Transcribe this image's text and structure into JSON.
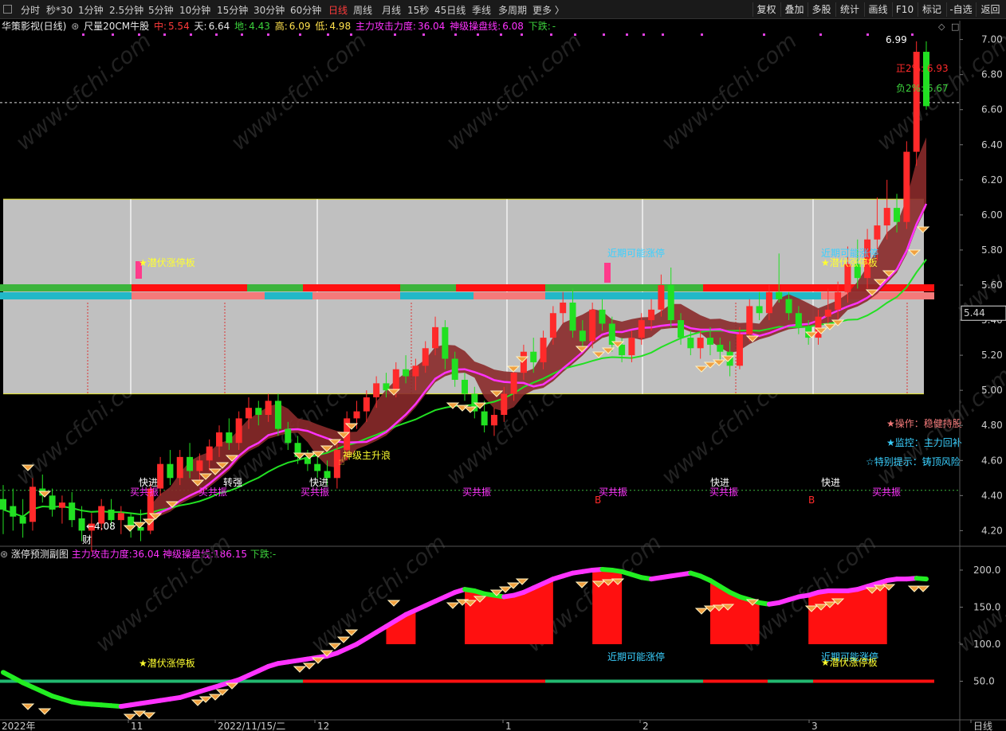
{
  "toolbar": {
    "timeframes": [
      "分时",
      "秒*30",
      "1分钟",
      "2.5分钟",
      "5分钟",
      "10分钟",
      "15分钟",
      "30分钟",
      "60分钟",
      "日线",
      "周线",
      "月线",
      "15秒",
      "45日线",
      "季线",
      "多周期",
      "更多 〉"
    ],
    "active_timeframe": "日线",
    "right_buttons": [
      "复权",
      "叠加",
      "多股",
      "统计",
      "画线",
      "F10",
      "标记",
      "-自选",
      "返回"
    ]
  },
  "info": {
    "stock_name": "华策影视(日线)",
    "indicator": "尺量20CM牛股",
    "zhong_label": "中:",
    "zhong": "5.54",
    "tian_label": "天:",
    "tian": "6.64",
    "di_label": "地:",
    "di": "4.43",
    "gao_label": "高:",
    "gao": "6.09",
    "low_label": "低:",
    "low": "4.98",
    "main_force_label": "主力攻击力度:",
    "main_force": "36.04",
    "shenji_label": "神级操盘线:",
    "shenji": "6.08",
    "down_label": "下跌:",
    "down": "-"
  },
  "sub_header": {
    "name": "涨停预测副图",
    "main_force_label": "主力攻击力度:",
    "main_force": "36.04",
    "shenji_label": "神级操盘线:",
    "shenji": "186.15",
    "down_label": "下跌:",
    "down": "-"
  },
  "chart_data": [
    {
      "type": "candlestick",
      "panel": "main",
      "title": "华策影视(日线)",
      "ylim": [
        4.12,
        7.08
      ],
      "y_ticks": [
        "7.00",
        "6.80",
        "6.60",
        "6.40",
        "6.20",
        "6.00",
        "5.80",
        "5.60",
        "5.40",
        "5.20",
        "5.00",
        "4.80",
        "4.60",
        "4.40",
        "4.20"
      ],
      "current_price": "5.44",
      "x_labels": [
        "2022年",
        "11",
        "2022/11/15/二",
        "12",
        "1",
        "2",
        "3",
        "日线"
      ],
      "ohlc": [
        [
          4.38,
          4.46,
          4.18,
          4.32
        ],
        [
          4.34,
          4.44,
          4.2,
          4.28
        ],
        [
          4.28,
          4.38,
          4.16,
          4.24
        ],
        [
          4.25,
          4.5,
          4.2,
          4.45
        ],
        [
          4.44,
          4.52,
          4.36,
          4.4
        ],
        [
          4.4,
          4.44,
          4.28,
          4.32
        ],
        [
          4.33,
          4.4,
          4.24,
          4.36
        ],
        [
          4.36,
          4.42,
          4.22,
          4.26
        ],
        [
          4.27,
          4.34,
          4.14,
          4.2
        ],
        [
          4.2,
          4.3,
          4.08,
          4.24
        ],
        [
          4.24,
          4.38,
          4.2,
          4.34
        ],
        [
          4.32,
          4.38,
          4.22,
          4.26
        ],
        [
          4.26,
          4.34,
          4.18,
          4.3
        ],
        [
          4.28,
          4.3,
          4.16,
          4.22
        ],
        [
          4.22,
          4.32,
          4.14,
          4.2
        ],
        [
          4.2,
          4.48,
          4.18,
          4.44
        ],
        [
          4.44,
          4.62,
          4.4,
          4.58
        ],
        [
          4.58,
          4.66,
          4.46,
          4.5
        ],
        [
          4.5,
          4.66,
          4.46,
          4.62
        ],
        [
          4.62,
          4.7,
          4.5,
          4.54
        ],
        [
          4.54,
          4.64,
          4.46,
          4.6
        ],
        [
          4.6,
          4.72,
          4.54,
          4.68
        ],
        [
          4.68,
          4.8,
          4.62,
          4.76
        ],
        [
          4.76,
          4.84,
          4.66,
          4.7
        ],
        [
          4.7,
          4.88,
          4.66,
          4.84
        ],
        [
          4.84,
          4.96,
          4.78,
          4.9
        ],
        [
          4.9,
          4.94,
          4.8,
          4.86
        ],
        [
          4.86,
          4.98,
          4.82,
          4.94
        ],
        [
          4.94,
          4.98,
          4.74,
          4.78
        ],
        [
          4.78,
          4.82,
          4.66,
          4.7
        ],
        [
          4.7,
          4.74,
          4.58,
          4.62
        ],
        [
          4.62,
          4.66,
          4.54,
          4.58
        ],
        [
          4.58,
          4.62,
          4.5,
          4.54
        ],
        [
          4.54,
          4.6,
          4.46,
          4.5
        ],
        [
          4.5,
          4.7,
          4.44,
          4.66
        ],
        [
          4.66,
          4.88,
          4.6,
          4.84
        ],
        [
          4.84,
          4.94,
          4.78,
          4.88
        ],
        [
          4.88,
          5.0,
          4.82,
          4.96
        ],
        [
          4.96,
          5.08,
          4.9,
          5.04
        ],
        [
          5.04,
          5.1,
          4.96,
          5.0
        ],
        [
          5.0,
          5.16,
          4.96,
          5.12
        ],
        [
          5.12,
          5.2,
          5.04,
          5.08
        ],
        [
          5.08,
          5.18,
          5.0,
          5.14
        ],
        [
          5.14,
          5.28,
          5.1,
          5.24
        ],
        [
          5.24,
          5.42,
          5.2,
          5.36
        ],
        [
          5.36,
          5.4,
          5.12,
          5.18
        ],
        [
          5.18,
          5.22,
          5.02,
          5.06
        ],
        [
          5.06,
          5.1,
          4.94,
          4.98
        ],
        [
          4.98,
          5.02,
          4.84,
          4.88
        ],
        [
          4.88,
          4.94,
          4.76,
          4.8
        ],
        [
          4.8,
          4.9,
          4.74,
          4.86
        ],
        [
          4.86,
          5.02,
          4.82,
          4.98
        ],
        [
          4.98,
          5.14,
          4.94,
          5.1
        ],
        [
          5.1,
          5.26,
          5.06,
          5.22
        ],
        [
          5.22,
          5.3,
          5.1,
          5.16
        ],
        [
          5.16,
          5.34,
          5.12,
          5.3
        ],
        [
          5.3,
          5.48,
          5.26,
          5.44
        ],
        [
          5.44,
          5.56,
          5.38,
          5.5
        ],
        [
          5.5,
          5.58,
          5.3,
          5.34
        ],
        [
          5.34,
          5.4,
          5.24,
          5.28
        ],
        [
          5.28,
          5.5,
          5.24,
          5.46
        ],
        [
          5.46,
          5.52,
          5.34,
          5.38
        ],
        [
          5.38,
          5.42,
          5.22,
          5.26
        ],
        [
          5.26,
          5.3,
          5.16,
          5.2
        ],
        [
          5.2,
          5.34,
          5.16,
          5.3
        ],
        [
          5.3,
          5.44,
          5.26,
          5.4
        ],
        [
          5.4,
          5.52,
          5.34,
          5.46
        ],
        [
          5.46,
          5.66,
          5.42,
          5.6
        ],
        [
          5.6,
          5.7,
          5.36,
          5.4
        ],
        [
          5.4,
          5.44,
          5.26,
          5.3
        ],
        [
          5.3,
          5.34,
          5.2,
          5.24
        ],
        [
          5.24,
          5.34,
          5.18,
          5.3
        ],
        [
          5.3,
          5.36,
          5.2,
          5.26
        ],
        [
          5.26,
          5.3,
          5.16,
          5.22
        ],
        [
          5.22,
          5.28,
          5.08,
          5.14
        ],
        [
          5.14,
          5.36,
          5.12,
          5.32
        ],
        [
          5.32,
          5.52,
          5.28,
          5.48
        ],
        [
          5.48,
          5.56,
          5.4,
          5.44
        ],
        [
          5.44,
          5.6,
          5.4,
          5.56
        ],
        [
          5.56,
          5.78,
          5.5,
          5.52
        ],
        [
          5.52,
          5.56,
          5.4,
          5.44
        ],
        [
          5.44,
          5.48,
          5.32,
          5.36
        ],
        [
          5.36,
          5.4,
          5.26,
          5.3
        ],
        [
          5.3,
          5.46,
          5.26,
          5.42
        ],
        [
          5.42,
          5.58,
          5.38,
          5.46
        ],
        [
          5.46,
          5.62,
          5.4,
          5.56
        ],
        [
          5.56,
          5.82,
          5.5,
          5.72
        ],
        [
          5.72,
          5.86,
          5.58,
          5.64
        ],
        [
          5.64,
          5.92,
          5.58,
          5.86
        ],
        [
          5.86,
          6.1,
          5.74,
          5.94
        ],
        [
          5.94,
          6.2,
          5.86,
          6.04
        ],
        [
          6.04,
          6.12,
          5.9,
          5.96
        ],
        [
          5.96,
          6.42,
          5.92,
          6.36
        ],
        [
          6.36,
          6.99,
          6.28,
          6.93
        ],
        [
          6.93,
          6.99,
          6.6,
          6.62
        ]
      ],
      "annotations": [
        "★潜伏涨停板",
        "近期可能涨停",
        "近期可能涨停",
        "★潜伏涨停板",
        "神级主升浪",
        "快进",
        "转强",
        "快进",
        "快进",
        "快进",
        "买共振",
        "买共振",
        "买共振",
        "买共振",
        "买共振",
        "买共振",
        "买共振",
        "B",
        "B",
        "←4.08",
        "财",
        "6.99",
        "正2%: 6.93",
        "负2%: 6.67"
      ],
      "side_notes": [
        "★操作：稳健持股",
        "★监控：主力回补",
        "☆特别提示：铸顶风险"
      ]
    },
    {
      "type": "area",
      "panel": "sub",
      "title": "涨停预测副图",
      "ylim": [
        0,
        215
      ],
      "y_ticks": [
        "200.0",
        "150.0",
        "100.0",
        "50.0"
      ],
      "values": [
        62,
        55,
        48,
        42,
        36,
        30,
        26,
        22,
        20,
        19,
        18,
        17,
        16,
        18,
        20,
        22,
        24,
        26,
        28,
        32,
        36,
        40,
        44,
        48,
        52,
        58,
        64,
        70,
        74,
        76,
        78,
        80,
        82,
        84,
        88,
        94,
        100,
        108,
        116,
        124,
        132,
        140,
        146,
        152,
        158,
        164,
        170,
        174,
        172,
        168,
        166,
        164,
        166,
        170,
        176,
        182,
        188,
        192,
        196,
        198,
        200,
        201,
        200,
        198,
        194,
        190,
        188,
        190,
        192,
        194,
        196,
        192,
        186,
        178,
        170,
        164,
        160,
        156,
        154,
        156,
        160,
        164,
        166,
        170,
        172,
        172,
        172,
        174,
        178,
        182,
        186,
        188,
        188,
        189,
        188,
        187
      ]
    }
  ],
  "watermark": "www.cfchi.com"
}
